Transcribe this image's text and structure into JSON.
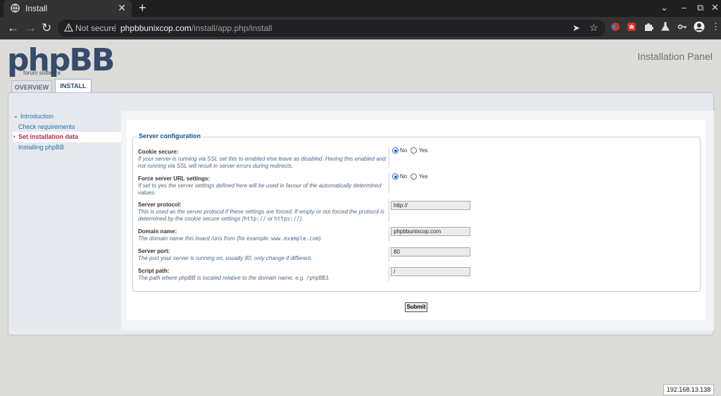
{
  "browser": {
    "tab_title": "Install",
    "new_tab": "+",
    "close": "✕",
    "win_min": "–",
    "win_max": "⧉",
    "win_close": "✕",
    "back": "←",
    "forward": "→",
    "reload": "↻",
    "security": "Not secure",
    "url_host": "phpbbunixcop.com",
    "url_path": "/install/app.php/install",
    "icons": [
      "send-icon",
      "star-icon",
      "extension-icons",
      "profile-avatar"
    ]
  },
  "header": {
    "logo_word": "phpBB",
    "logo_sub": "forum   software",
    "panel_title": "Installation Panel"
  },
  "tabs": {
    "overview": "OVERVIEW",
    "install": "INSTALL"
  },
  "menu": [
    {
      "label": "Introduction"
    },
    {
      "label": "Check requirements"
    },
    {
      "label": "Set installation data"
    },
    {
      "label": "Installing phpBB"
    }
  ],
  "form": {
    "legend": "Server configuration",
    "cookie": {
      "label": "Cookie secure:",
      "desc": "If your server is running via SSL set this to enabled else leave as disabled. Having this enabled and not running via SSL will result in server errors during redirects.",
      "no": "No",
      "yes": "Yes",
      "selected": "No"
    },
    "force": {
      "label": "Force server URL settings:",
      "desc": "If set to yes the server settings defined here will be used in favour of the automatically determined values.",
      "no": "No",
      "yes": "Yes",
      "selected": "No"
    },
    "protocol": {
      "label": "Server protocol:",
      "desc_a": "This is used as the server protocol if these settings are forced. If empty or not forced the protocol is determined by the cookie secure settings (",
      "code1": "http://",
      "desc_b": " or ",
      "code2": "https://",
      "desc_c": ").",
      "value": "http://"
    },
    "domain": {
      "label": "Domain name:",
      "desc_a": "The domain name this board runs from (for example: ",
      "code": "www.example.com",
      "desc_b": ").",
      "value": "phpbbunixcop.com"
    },
    "port": {
      "label": "Server port:",
      "desc": "The port your server is running on, usually 80, only change if different.",
      "value": "80"
    },
    "script": {
      "label": "Script path:",
      "desc_a": "The path where phpBB is located relative to the domain name, e.g. ",
      "code": "/phpBB3",
      "desc_b": ".",
      "value": "/"
    },
    "submit": "Submit"
  },
  "ip_badge": "192.168.13.138",
  "colors": {
    "accent": "#145083",
    "menu_link": "#2670a6",
    "menu_active": "#bc2a4d"
  }
}
